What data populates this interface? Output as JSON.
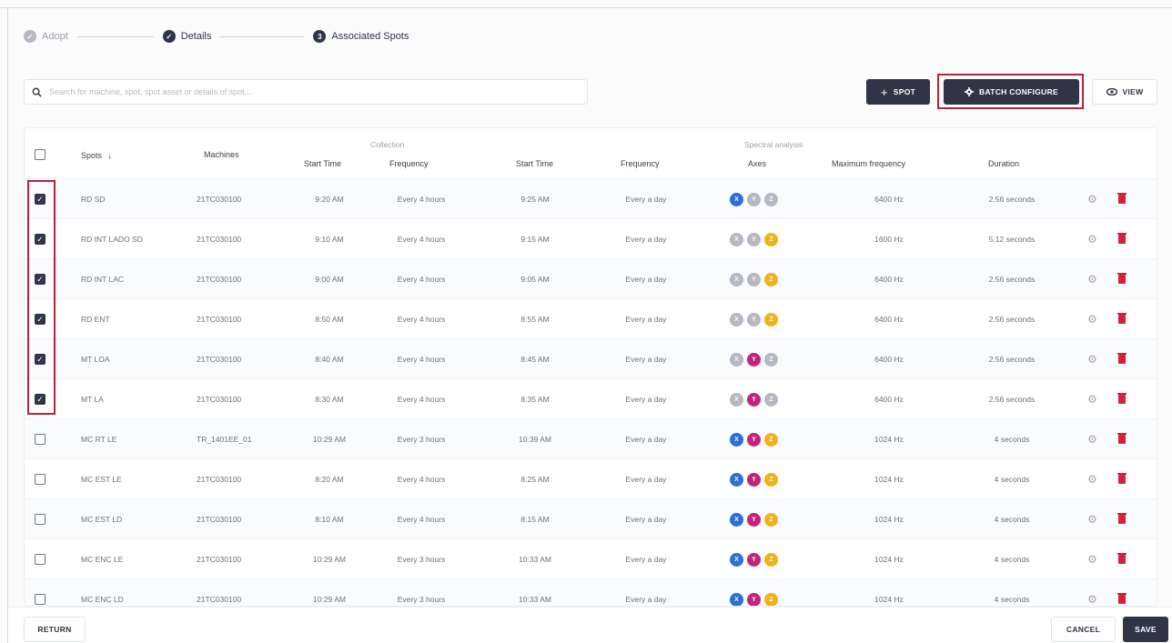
{
  "stepper": {
    "steps": [
      {
        "label": "Adopt",
        "state": "done-light",
        "badge": "✓"
      },
      {
        "label": "Details",
        "state": "done",
        "badge": "✓"
      },
      {
        "label": "Associated Spots",
        "state": "current",
        "badge": "3"
      }
    ]
  },
  "search": {
    "placeholder": "Search for machine, spot, spot asset or details of spot...",
    "icon": "search-icon"
  },
  "toolbar": {
    "spot_label": "SPOT",
    "spot_icon": "+",
    "batch_label": "BATCH CONFIGURE",
    "view_label": "VIEW"
  },
  "table": {
    "group_headers": {
      "collection": "Collection",
      "spectral": "Spectral analysis"
    },
    "columns": {
      "spots": "Spots",
      "machines": "Machines",
      "start_time_1": "Start Time",
      "frequency_1": "Frequency",
      "start_time_2": "Start Time",
      "frequency_2": "Frequency",
      "axes": "Axes",
      "max_freq": "Maximum frequency",
      "duration": "Duration"
    },
    "rows": [
      {
        "checked": true,
        "spot": "RD SD",
        "machine": "21TC030100",
        "start1": "9:20 AM",
        "freq1": "Every 4 hours",
        "start2": "9:25 AM",
        "freq2": "Every a day",
        "axes": [
          "x",
          "y",
          "z"
        ],
        "axes_on": [
          true,
          false,
          false
        ],
        "max_freq": "6400 Hz",
        "duration": "2.56 seconds"
      },
      {
        "checked": true,
        "spot": "RD INT LADO SD",
        "machine": "21TC030100",
        "start1": "9:10 AM",
        "freq1": "Every 4 hours",
        "start2": "9:15 AM",
        "freq2": "Every a day",
        "axes": [
          "x",
          "y",
          "z"
        ],
        "axes_on": [
          false,
          false,
          true
        ],
        "max_freq": "1600 Hz",
        "duration": "5.12 seconds"
      },
      {
        "checked": true,
        "spot": "RD INT LAC",
        "machine": "21TC030100",
        "start1": "9:00 AM",
        "freq1": "Every 4 hours",
        "start2": "9:05 AM",
        "freq2": "Every a day",
        "axes": [
          "x",
          "y",
          "z"
        ],
        "axes_on": [
          false,
          false,
          true
        ],
        "max_freq": "6400 Hz",
        "duration": "2.56 seconds"
      },
      {
        "checked": true,
        "spot": "RD ENT",
        "machine": "21TC030100",
        "start1": "8:50 AM",
        "freq1": "Every 4 hours",
        "start2": "8:55 AM",
        "freq2": "Every a day",
        "axes": [
          "x",
          "y",
          "z"
        ],
        "axes_on": [
          false,
          false,
          true
        ],
        "max_freq": "6400 Hz",
        "duration": "2.56 seconds"
      },
      {
        "checked": true,
        "spot": "MT LOA",
        "machine": "21TC030100",
        "start1": "8:40 AM",
        "freq1": "Every 4 hours",
        "start2": "8:45 AM",
        "freq2": "Every a day",
        "axes": [
          "x",
          "y",
          "z"
        ],
        "axes_on": [
          false,
          true,
          false
        ],
        "max_freq": "6400 Hz",
        "duration": "2.56 seconds"
      },
      {
        "checked": true,
        "spot": "MT LA",
        "machine": "21TC030100",
        "start1": "8:30 AM",
        "freq1": "Every 4 hours",
        "start2": "8:35 AM",
        "freq2": "Every a day",
        "axes": [
          "x",
          "y",
          "z"
        ],
        "axes_on": [
          false,
          true,
          false
        ],
        "max_freq": "6400 Hz",
        "duration": "2.56 seconds"
      },
      {
        "checked": false,
        "spot": "MC RT LE",
        "machine": "TR_1401EE_01",
        "start1": "10:29 AM",
        "freq1": "Every 3 hours",
        "start2": "10:39 AM",
        "freq2": "Every a day",
        "axes": [
          "x",
          "y",
          "z"
        ],
        "axes_on": [
          true,
          true,
          true
        ],
        "max_freq": "1024 Hz",
        "duration": "4 seconds"
      },
      {
        "checked": false,
        "spot": "MC EST LE",
        "machine": "21TC030100",
        "start1": "8:20 AM",
        "freq1": "Every 4 hours",
        "start2": "8:25 AM",
        "freq2": "Every a day",
        "axes": [
          "x",
          "y",
          "z"
        ],
        "axes_on": [
          true,
          true,
          true
        ],
        "max_freq": "1024 Hz",
        "duration": "4 seconds"
      },
      {
        "checked": false,
        "spot": "MC EST LD",
        "machine": "21TC030100",
        "start1": "8:10 AM",
        "freq1": "Every 4 hours",
        "start2": "8:15 AM",
        "freq2": "Every a day",
        "axes": [
          "x",
          "y",
          "z"
        ],
        "axes_on": [
          true,
          true,
          true
        ],
        "max_freq": "1024 Hz",
        "duration": "4 seconds"
      },
      {
        "checked": false,
        "spot": "MC ENC LE",
        "machine": "21TC030100",
        "start1": "10:29 AM",
        "freq1": "Every 3 hours",
        "start2": "10:33 AM",
        "freq2": "Every a day",
        "axes": [
          "x",
          "y",
          "z"
        ],
        "axes_on": [
          true,
          true,
          true
        ],
        "max_freq": "1024 Hz",
        "duration": "4 seconds"
      },
      {
        "checked": false,
        "spot": "MC ENC LD",
        "machine": "21TC030100",
        "start1": "10:29 AM",
        "freq1": "Every 3 hours",
        "start2": "10:33 AM",
        "freq2": "Every a day",
        "axes": [
          "x",
          "y",
          "z"
        ],
        "axes_on": [
          true,
          true,
          true
        ],
        "max_freq": "1024 Hz",
        "duration": "4 seconds"
      }
    ]
  },
  "axis_colors": {
    "x": "#2d6fd6",
    "y": "#c2247a",
    "z": "#f0b315",
    "off": "#b4b8c0"
  },
  "footer": {
    "return_label": "RETURN",
    "cancel_label": "CANCEL",
    "save_label": "SAVE"
  }
}
